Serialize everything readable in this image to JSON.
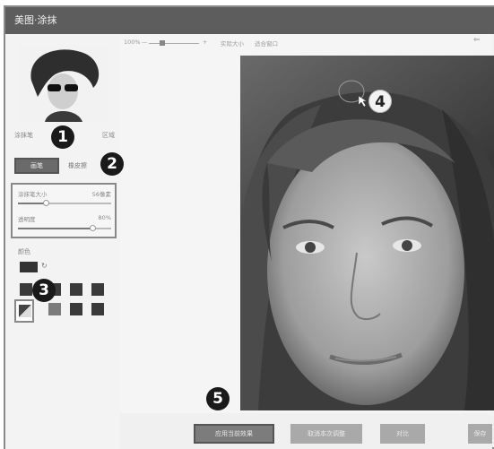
{
  "window": {
    "title": "美图·涂抹"
  },
  "left_panel": {
    "caption_left": "涂抹笔",
    "caption_right": "区域",
    "brush_button": "画笔",
    "eraser_label": "橡皮擦",
    "brush_size_label": "涂抹笔大小",
    "brush_size_value": "56像素",
    "brush_size_fraction": 0.3,
    "opacity_label": "透明度",
    "opacity_value": "80%",
    "opacity_fraction": 0.8,
    "color_label": "颜色"
  },
  "zoom_bar": {
    "zoom_value": "100%",
    "minus": "—",
    "plus": "+",
    "actual_size": "实际大小",
    "fit_window": "适合窗口"
  },
  "bottom_bar": {
    "apply_button": "应用当前效果",
    "cancel_button": "取消本次调整",
    "compare_button": "对比",
    "save_button": "保存"
  },
  "markers": {
    "m1": "1",
    "m2": "2",
    "m3": "3",
    "m4": "4",
    "m5": "5"
  },
  "colors": {
    "accent": "#7c7c7c",
    "titlebar": "#5d5d5d",
    "swatch_dark": "#3a3a3a"
  }
}
